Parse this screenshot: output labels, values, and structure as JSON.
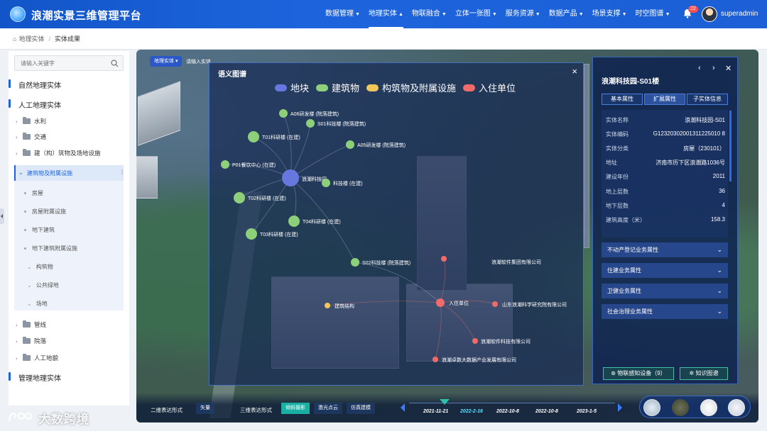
{
  "header": {
    "app_title": "浪潮实景三维管理平台",
    "nav": [
      {
        "label": "数据管理",
        "active": false
      },
      {
        "label": "地理实体",
        "active": true
      },
      {
        "label": "物联融合",
        "active": false
      },
      {
        "label": "立体一张图",
        "active": false
      },
      {
        "label": "服务资源",
        "active": false
      },
      {
        "label": "数据产品",
        "active": false
      },
      {
        "label": "场景支撑",
        "active": false
      },
      {
        "label": "时空图谱",
        "active": false
      }
    ],
    "notification_count": "22",
    "username": "superadmin",
    "accent_color": "#1d64dc"
  },
  "breadcrumb": {
    "home": "地理实体",
    "separator": "/",
    "current": "实体成果"
  },
  "sidebar": {
    "search_placeholder": "请输入关键字",
    "roots": [
      "自然地理实体",
      "人工地理实体",
      "管理地理实体"
    ],
    "folders_top": [
      "水利",
      "交通",
      "建（构）筑物及场地设施"
    ],
    "selected": "建筑物及附属设施",
    "sub_items": [
      "房屋",
      "房屋附属设施",
      "地下建筑",
      "地下建筑附属设施"
    ],
    "sub_items_2": [
      "构筑物",
      "公共绿地",
      "场地"
    ],
    "folders_bottom": [
      "管线",
      "院落",
      "人工地貌"
    ]
  },
  "map": {
    "pill": "地理实体 ▾",
    "hint": "请输入实体"
  },
  "graph": {
    "title": "语义图谱",
    "close": "×",
    "legend": [
      {
        "label": "地块",
        "color": "#6677dd"
      },
      {
        "label": "建筑物",
        "color": "#8ed07a"
      },
      {
        "label": "构筑物及附属设施",
        "color": "#f0c75a"
      },
      {
        "label": "入住单位",
        "color": "#f26b6b"
      }
    ],
    "nodes": [
      {
        "label": "浪潮科技园",
        "type": "plot"
      },
      {
        "label": "A06研发楼 (院落建筑)",
        "type": "building"
      },
      {
        "label": "S01科技楼 (院落建筑)",
        "type": "building"
      },
      {
        "label": "T01科研楼 (在建)",
        "type": "building"
      },
      {
        "label": "A05研发楼 (院落建筑)",
        "type": "building"
      },
      {
        "label": "P01餐饮中心 (在建)",
        "type": "building"
      },
      {
        "label": "科技楼 (在建)",
        "type": "building"
      },
      {
        "label": "T02科研楼 (在建)",
        "type": "building"
      },
      {
        "label": "T04科研楼 (在建)",
        "type": "building"
      },
      {
        "label": "T03科研楼 (在建)",
        "type": "building"
      },
      {
        "label": "S02科技楼 (院落建筑)",
        "type": "building"
      },
      {
        "label": "浪潮软件集团有限公司",
        "type": "unit"
      },
      {
        "label": "入住单位",
        "type": "unit"
      },
      {
        "label": "山东浪潮科学研究院有限公司",
        "type": "unit"
      },
      {
        "label": "浪潮软件科技有限公司",
        "type": "unit"
      },
      {
        "label": "浪潮卓数大数据产业发展有限公司",
        "type": "unit"
      },
      {
        "label": "建筑结构",
        "type": "structure"
      }
    ]
  },
  "info": {
    "title": "浪潮科技园-S01楼",
    "tabs": [
      "基本属性",
      "扩展属性",
      "子实体信息"
    ],
    "active_tab": 1,
    "attributes": [
      {
        "key": "实体名称",
        "value": "浪潮科技园-S01"
      },
      {
        "key": "实体编码",
        "value": "G12320302001311225010 8"
      },
      {
        "key": "实体分类",
        "value": "房屋（230101）"
      },
      {
        "key": "地址",
        "value": "济南市历下区浪潮路1036号"
      },
      {
        "key": "建设年份",
        "value": "2011"
      },
      {
        "key": "地上层数",
        "value": "36"
      },
      {
        "key": "地下层数",
        "value": "4"
      },
      {
        "key": "建筑高度（米）",
        "value": "158.3"
      }
    ],
    "sections": [
      "不动产登记业务属性",
      "住建业务属性",
      "卫健业务属性",
      "社会治理业务属性"
    ],
    "btn_iot": "物联感知设备（9）",
    "btn_graph": "知识图谱"
  },
  "bottom": {
    "label_2d": "二维表达形式",
    "opt_2d": "矢量",
    "label_3d": "三维表达形式",
    "opts_3d": [
      "倾斜摄影",
      "激光点云",
      "仿真建模"
    ],
    "opts_3d_active": 0,
    "dates": [
      "2021-11-21",
      "2022-2-16",
      "2022-10-8",
      "2022-10-8",
      "2023-1-5"
    ],
    "current_date_index": 1
  },
  "watermark": "大数跨境"
}
